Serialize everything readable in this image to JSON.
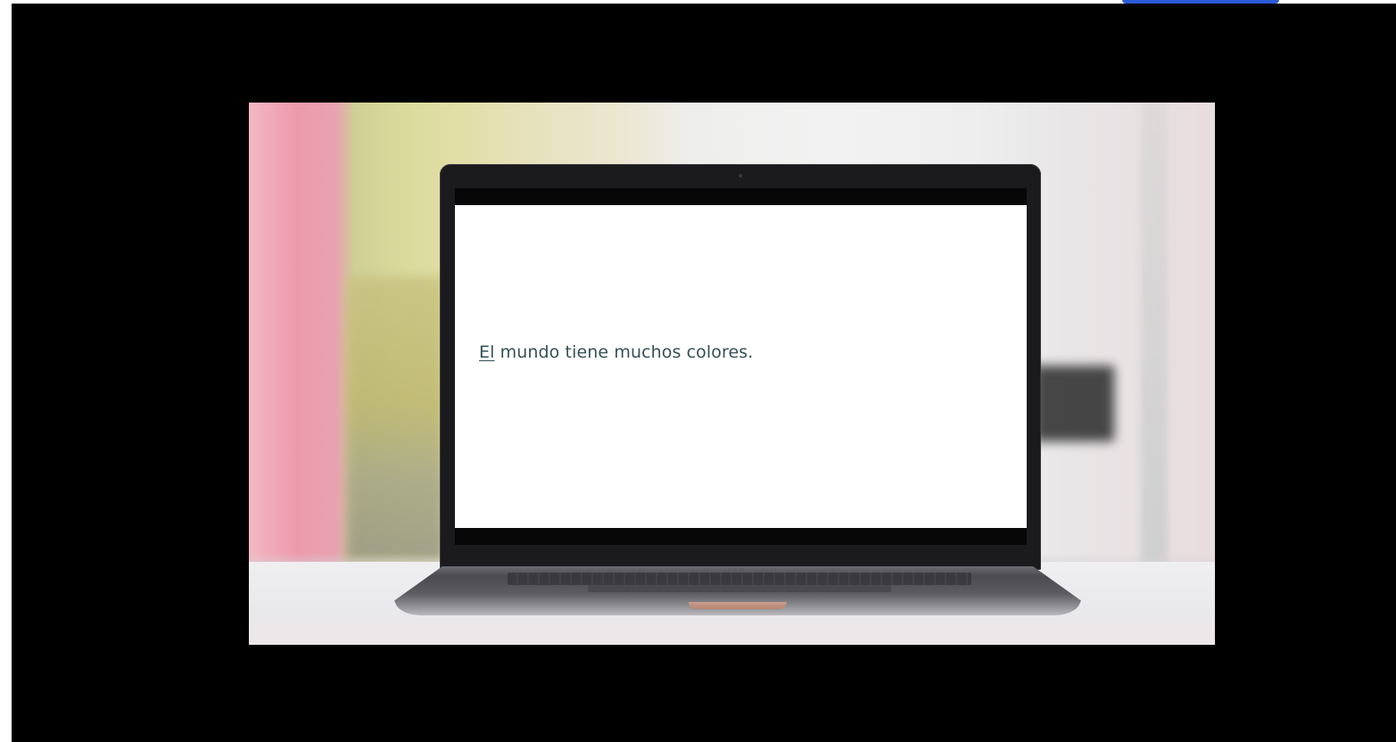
{
  "video": {
    "slide_text": {
      "first_word": "El",
      "rest": " mundo tiene muchos colores."
    }
  }
}
